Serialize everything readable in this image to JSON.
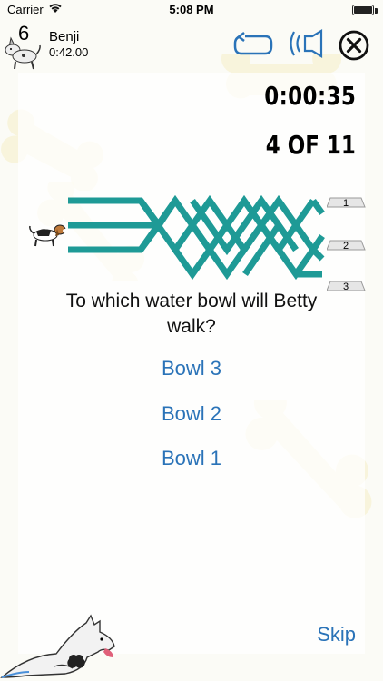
{
  "status_bar": {
    "carrier": "Carrier",
    "time": "5:08 PM"
  },
  "header": {
    "level": "6",
    "player_name": "Benji",
    "player_time": "0:42.00",
    "icons": {
      "replay": "replay-icon",
      "sound": "speaker-icon",
      "close": "close-icon"
    }
  },
  "game": {
    "timer": "0:00:35",
    "progress": "4 OF 11",
    "question": "To which water bowl will Betty walk?",
    "bowls": [
      "1",
      "2",
      "3"
    ],
    "answers": [
      "Bowl 3",
      "Bowl 2",
      "Bowl 1"
    ],
    "skip_label": "Skip"
  },
  "colors": {
    "maze": "#1e9a96",
    "link": "#2a73b8",
    "bone": "#f5efc9"
  }
}
